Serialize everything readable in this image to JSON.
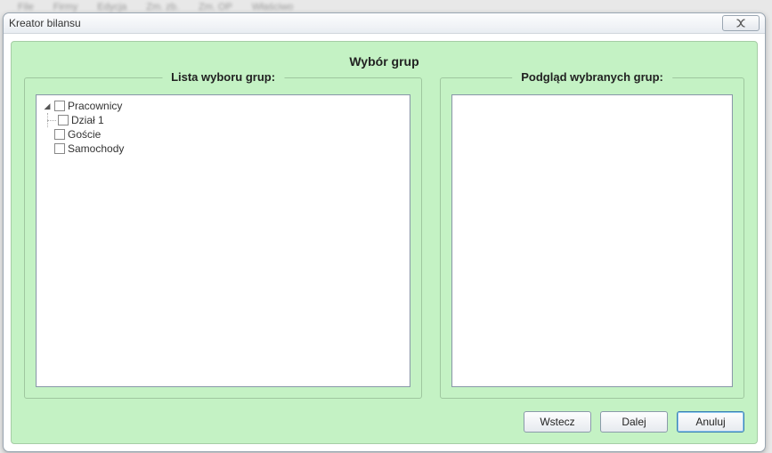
{
  "bg_menu": [
    "File",
    "Firmy",
    "Edycja",
    "Zm. zb.",
    "Zm. OP",
    "Właściwo"
  ],
  "window": {
    "title": "Kreator bilansu"
  },
  "heading": "Wybór grup",
  "left_box": {
    "title": "Lista wyboru grup:"
  },
  "right_box": {
    "title": "Podgląd wybranych grup:"
  },
  "tree": {
    "root1": "Pracownicy",
    "root1_child1": "Dział 1",
    "root2": "Goście",
    "root3": "Samochody"
  },
  "buttons": {
    "back": "Wstecz",
    "next": "Dalej",
    "cancel": "Anuluj"
  }
}
